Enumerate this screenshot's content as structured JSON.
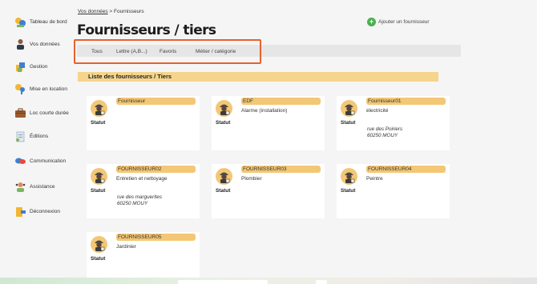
{
  "sidebar": {
    "items": [
      {
        "label": "Tableau de bord",
        "icon": "dashboard-icon"
      },
      {
        "label": "Vos données",
        "icon": "user-data-icon"
      },
      {
        "label": "Gestion",
        "icon": "management-icon"
      },
      {
        "label": "Mise en location",
        "icon": "rental-key-icon"
      },
      {
        "label": "Loc courte durée",
        "icon": "suitcase-icon"
      },
      {
        "label": "Éditions",
        "icon": "document-icon"
      },
      {
        "label": "Communication",
        "icon": "chat-icon"
      },
      {
        "label": "Assistance",
        "icon": "support-icon"
      },
      {
        "label": "Déconnexion",
        "icon": "logout-icon"
      }
    ]
  },
  "breadcrumb": {
    "link": "Vos données",
    "separator": ">",
    "current": "Fournisseurs"
  },
  "page_title": "Fournisseurs / tiers",
  "add_button_label": "Ajouter un fournisseur",
  "filter_tabs": [
    "Tous",
    "Lettre (A,B...)",
    "Favoris",
    "Métier / catégorie"
  ],
  "section_title": "Liste des fournisseurs / Tiers",
  "cards": [
    {
      "name": "Fournisseur",
      "category": "",
      "status_label": "Statut",
      "address_line1": "",
      "address_line2": ""
    },
    {
      "name": "EDF",
      "category": "Alarme (installation)",
      "status_label": "Statut",
      "address_line1": "",
      "address_line2": ""
    },
    {
      "name": "Fournisseur01",
      "category": "électricité",
      "status_label": "Statut",
      "address_line1": "rue des Poiriers",
      "address_line2": "60250 MOUY"
    },
    {
      "name": "FOURNISSEUR02",
      "category": "Entretien et nettoyage",
      "status_label": "Statut",
      "address_line1": "rue des marguerites",
      "address_line2": "60250 MOUY"
    },
    {
      "name": "FOURNISSEUR03",
      "category": "Plombier",
      "status_label": "Statut",
      "address_line1": "",
      "address_line2": ""
    },
    {
      "name": "FOURNISSEUR04",
      "category": "Peintre",
      "status_label": "Statut",
      "address_line1": "",
      "address_line2": ""
    },
    {
      "name": "FOURNISSEUR05",
      "category": "Jardinier",
      "status_label": "Statut",
      "address_line1": "",
      "address_line2": ""
    }
  ],
  "colors": {
    "accent_yellow": "#f3c775",
    "section_yellow": "#f5d58c",
    "highlight_orange": "#e8612c",
    "add_green": "#4caf50"
  }
}
